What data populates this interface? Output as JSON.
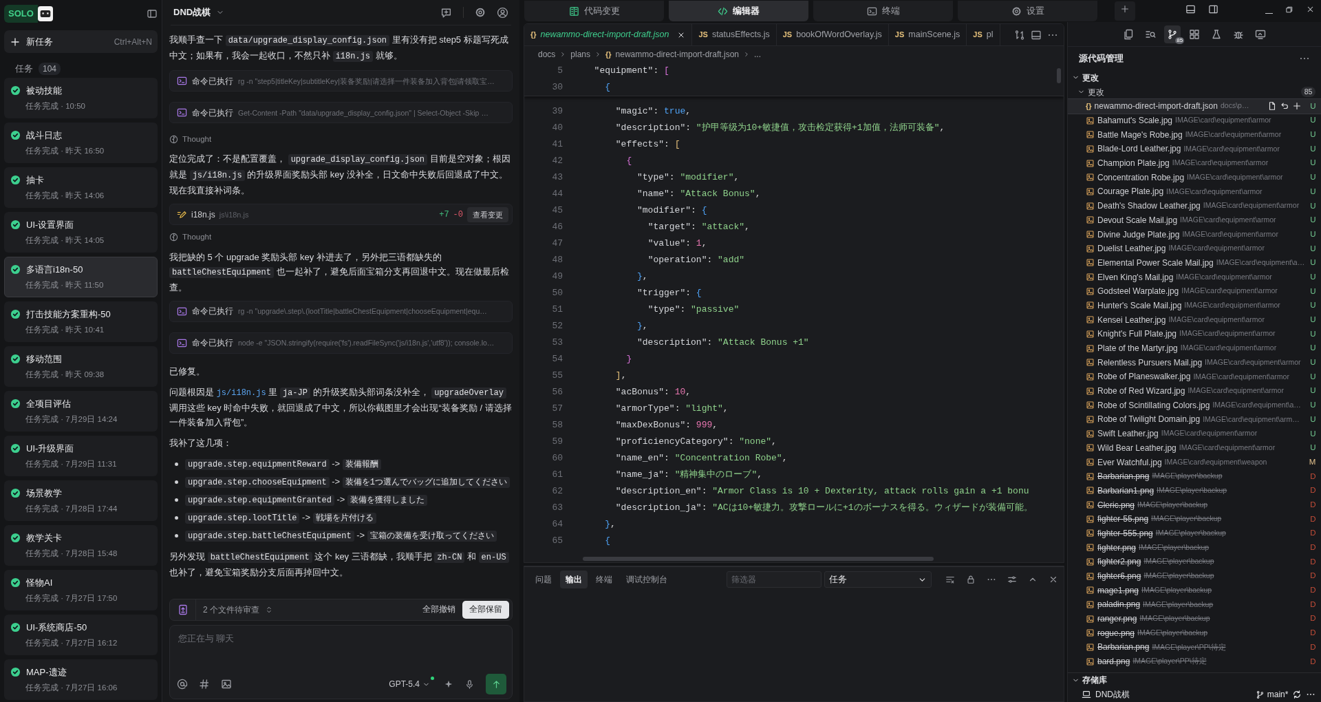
{
  "sidebar": {
    "logo": "SOLO",
    "new_task": {
      "label": "新任务",
      "shortcut": "Ctrl+Alt+N"
    },
    "tasks_label": "任务",
    "tasks_count": "104",
    "items": [
      {
        "title": "被动技能",
        "subtitle": "任务完成 · 10:50",
        "done": true,
        "selected": false
      },
      {
        "title": "战斗日志",
        "subtitle": "任务完成 · 昨天 16:50",
        "done": true,
        "selected": false
      },
      {
        "title": "抽卡",
        "subtitle": "任务完成 · 昨天 14:06",
        "done": true,
        "selected": false
      },
      {
        "title": "UI-设置界面",
        "subtitle": "任务完成 · 昨天 14:05",
        "done": true,
        "selected": false
      },
      {
        "title": "多语言i18n-50",
        "subtitle": "任务完成 · 昨天 11:50",
        "done": true,
        "selected": true
      },
      {
        "title": "打击技能方案重构-50",
        "subtitle": "任务完成 · 昨天 10:41",
        "done": true,
        "selected": false
      },
      {
        "title": "移动范围",
        "subtitle": "任务完成 · 昨天 09:38",
        "done": true,
        "selected": false
      },
      {
        "title": "全项目评估",
        "subtitle": "任务完成 · 7月29日 14:24",
        "done": true,
        "selected": false
      },
      {
        "title": "UI-升级界面",
        "subtitle": "任务完成 · 7月29日 11:31",
        "done": true,
        "selected": false
      },
      {
        "title": "场景教学",
        "subtitle": "任务完成 · 7月28日 17:44",
        "done": true,
        "selected": false
      },
      {
        "title": "教学关卡",
        "subtitle": "任务完成 · 7月28日 15:48",
        "done": true,
        "selected": false
      },
      {
        "title": "怪物AI",
        "subtitle": "任务完成 · 7月27日 17:50",
        "done": true,
        "selected": false
      },
      {
        "title": "UI-系统商店-50",
        "subtitle": "任务完成 · 7月27日 16:12",
        "done": true,
        "selected": false
      },
      {
        "title": "MAP-遗迹",
        "subtitle": "任务完成 · 7月27日 16:06",
        "done": true,
        "selected": false
      }
    ]
  },
  "chat": {
    "title": "DND战棋",
    "messages": [
      {
        "kind": "text",
        "segments": [
          {
            "text": "我顺手查一下 "
          },
          {
            "code": "data/upgrade_display_config.json"
          },
          {
            "text": " 里有没有把 step5 标题写死成中文；如果有，我会一起收口，不然只补 "
          },
          {
            "code": "i18n.js"
          },
          {
            "text": " 就够。"
          }
        ]
      },
      {
        "kind": "command",
        "label": "命令已执行",
        "command": "rg -n \"step5|titleKey|subtitleKey|装备奖励|请选择一件装备加入背包|请领取宝…"
      },
      {
        "kind": "command",
        "label": "命令已执行",
        "command": "Get-Content -Path \"data/upgrade_display_config.json\" | Select-Object -Skip …"
      },
      {
        "kind": "thought",
        "label": "Thought"
      },
      {
        "kind": "text",
        "segments": [
          {
            "text": "定位完成了：不是配置覆盖， "
          },
          {
            "code": "upgrade_display_config.json"
          },
          {
            "text": " 目前是空对象；根因就是 "
          },
          {
            "code": "js/i18n.js"
          },
          {
            "text": " 的升级界面奖励头部 key 没补全，日文命中失败后回退成了中文。现在我直接补词条。"
          }
        ]
      },
      {
        "kind": "file_edit",
        "name": "i18n.js",
        "path": "js\\i18n.js",
        "added": "+7",
        "removed": "-0",
        "button": "查看变更"
      },
      {
        "kind": "thought",
        "label": "Thought"
      },
      {
        "kind": "text",
        "segments": [
          {
            "text": "我把缺的 5 个 upgrade 奖励头部 key 补进去了，另外把三语都缺失的 "
          },
          {
            "code": "battleChestEquipment"
          },
          {
            "text": " 也一起补了，避免后面宝箱分支再回退中文。现在做最后检查。"
          }
        ]
      },
      {
        "kind": "command",
        "label": "命令已执行",
        "command": "rg -n \"upgrade\\.step\\.(lootTitle|battleChestEquipment|chooseEquipment|equ…"
      },
      {
        "kind": "command",
        "label": "命令已执行",
        "command": "node -e \"JSON.stringify(require('fs').readFileSync('js/i18n.js','utf8')); console.lo…"
      },
      {
        "kind": "text",
        "segments": [
          {
            "text": "已修复。"
          }
        ]
      },
      {
        "kind": "text",
        "segments": [
          {
            "text": "问题根因是 "
          },
          {
            "link": "js/i18n.js"
          },
          {
            "text": " 里 "
          },
          {
            "code": "ja-JP"
          },
          {
            "text": " 的升级奖励头部词条没补全， "
          },
          {
            "code": "upgradeOverlay"
          },
          {
            "text": " 调用这些 key 时命中失败，就回退成了中文，所以你截图里才会出现“装备奖励 / 请选择一件装备加入背包”。"
          }
        ]
      },
      {
        "kind": "text",
        "segments": [
          {
            "text": "我补了这几项："
          }
        ]
      },
      {
        "kind": "list",
        "items": [
          [
            {
              "code": "upgrade.step.equipmentReward"
            },
            {
              "text": " -> "
            },
            {
              "code": "装備報酬"
            }
          ],
          [
            {
              "code": "upgrade.step.chooseEquipment"
            },
            {
              "text": " -> "
            },
            {
              "code": "装備を1つ選んでバッグに追加してください"
            }
          ],
          [
            {
              "code": "upgrade.step.equipmentGranted"
            },
            {
              "text": " -> "
            },
            {
              "code": "装備を獲得しました"
            }
          ],
          [
            {
              "code": "upgrade.step.lootTitle"
            },
            {
              "text": " -> "
            },
            {
              "code": "戦場を片付ける"
            }
          ],
          [
            {
              "code": "upgrade.step.battleChestEquipment"
            },
            {
              "text": " -> "
            },
            {
              "code": "宝箱の装備を受け取ってください"
            }
          ]
        ]
      },
      {
        "kind": "text",
        "segments": [
          {
            "text": "另外发现 "
          },
          {
            "code": "battleChestEquipment"
          },
          {
            "text": " 这个 key 三语都缺，我顺手把 "
          },
          {
            "code": "zh-CN"
          },
          {
            "text": " 和 "
          },
          {
            "code": "en-US"
          },
          {
            "text": " 也补了，避免宝箱奖励分支后面再掉回中文。"
          }
        ]
      }
    ],
    "review": {
      "label": "2 个文件待审查",
      "discard": "全部撤销",
      "keep": "全部保留"
    },
    "composer": {
      "placeholder": "您正在与 聊天",
      "model": "GPT-5.4"
    }
  },
  "top_tabs": [
    {
      "label": "代码变更",
      "kind": "diff",
      "selected": false
    },
    {
      "label": "编辑器",
      "kind": "code",
      "selected": true
    },
    {
      "label": "终端",
      "kind": "terminal",
      "selected": false
    },
    {
      "label": "设置",
      "kind": "gear",
      "selected": false
    }
  ],
  "editor": {
    "tabs": [
      {
        "glyph": "{}",
        "label": "newammo-direct-import-draft.json",
        "selected": true
      },
      {
        "glyph": "JS",
        "label": "statusEffects.js",
        "selected": false
      },
      {
        "glyph": "JS",
        "label": "bookOfWordOverlay.js",
        "selected": false
      },
      {
        "glyph": "JS",
        "label": "mainScene.js",
        "selected": false
      },
      {
        "glyph": "JS",
        "label": "pl",
        "selected": false
      }
    ],
    "breadcrumb": [
      {
        "text": "docs"
      },
      {
        "text": "plans"
      },
      {
        "glyph": "{}",
        "text": "newammo-direct-import-draft.json"
      },
      {
        "text": "..."
      }
    ],
    "sticky_lines": [
      {
        "number": "5",
        "code": "  \"equipment\": ["
      },
      {
        "number": "30",
        "code": "    {"
      }
    ],
    "lines": [
      {
        "number": "39",
        "code": "      \"magic\": true,"
      },
      {
        "number": "40",
        "code": "      \"description\": \"护甲等级为10+敏捷值，攻击检定获得+1加值，法师可装备\","
      },
      {
        "number": "41",
        "code": "      \"effects\": ["
      },
      {
        "number": "42",
        "code": "        {"
      },
      {
        "number": "43",
        "code": "          \"type\": \"modifier\","
      },
      {
        "number": "44",
        "code": "          \"name\": \"Attack Bonus\","
      },
      {
        "number": "45",
        "code": "          \"modifier\": {"
      },
      {
        "number": "46",
        "code": "            \"target\": \"attack\","
      },
      {
        "number": "47",
        "code": "            \"value\": 1,"
      },
      {
        "number": "48",
        "code": "            \"operation\": \"add\""
      },
      {
        "number": "49",
        "code": "          },"
      },
      {
        "number": "50",
        "code": "          \"trigger\": {"
      },
      {
        "number": "51",
        "code": "            \"type\": \"passive\""
      },
      {
        "number": "52",
        "code": "          },"
      },
      {
        "number": "53",
        "code": "          \"description\": \"Attack Bonus +1\""
      },
      {
        "number": "54",
        "code": "        }"
      },
      {
        "number": "55",
        "code": "      ],"
      },
      {
        "number": "56",
        "code": "      \"acBonus\": 10,"
      },
      {
        "number": "57",
        "code": "      \"armorType\": \"light\","
      },
      {
        "number": "58",
        "code": "      \"maxDexBonus\": 999,"
      },
      {
        "number": "59",
        "code": "      \"proficiencyCategory\": \"none\","
      },
      {
        "number": "60",
        "code": "      \"name_en\": \"Concentration Robe\","
      },
      {
        "number": "61",
        "code": "      \"name_ja\": \"精神集中のローブ\","
      },
      {
        "number": "62",
        "code": "      \"description_en\": \"Armor Class is 10 + Dexterity, attack rolls gain a +1 bonu"
      },
      {
        "number": "63",
        "code": "      \"description_ja\": \"ACは10+敏捷力。攻撃ロールに+1のボーナスを得る。ウィザードが装備可能。"
      },
      {
        "number": "64",
        "code": "    },"
      },
      {
        "number": "65",
        "code": "    {"
      }
    ]
  },
  "panel": {
    "tabs": [
      {
        "label": "问题",
        "selected": false
      },
      {
        "label": "输出",
        "selected": true
      },
      {
        "label": "终端",
        "selected": false
      },
      {
        "label": "调试控制台",
        "selected": false
      }
    ],
    "filter_placeholder": "筛选器",
    "channel": "任务"
  },
  "scm": {
    "activity": [
      {
        "kind": "files",
        "selected": false
      },
      {
        "kind": "search",
        "selected": false
      },
      {
        "kind": "branch",
        "selected": true,
        "badge": "85"
      },
      {
        "kind": "grid",
        "selected": false
      },
      {
        "kind": "flask",
        "selected": false
      },
      {
        "kind": "bug",
        "selected": false
      },
      {
        "kind": "remote",
        "selected": false
      }
    ],
    "title": "源代码管理",
    "section": {
      "label": "更改",
      "expanded": true
    },
    "group": {
      "label": "更改",
      "count": "85",
      "expanded": true
    },
    "files": [
      {
        "glyph": "{}",
        "name": "newammo-direct-import-draft.json",
        "path": "docs\\p…",
        "status": "U",
        "kind": "untracked",
        "selected": true
      },
      {
        "name": "Bahamut's Scale.jpg",
        "path": "IMAGE\\card\\equipment\\armor",
        "status": "U",
        "kind": "untracked",
        "selected": false
      },
      {
        "name": "Battle Mage's Robe.jpg",
        "path": "IMAGE\\card\\equipment\\armor",
        "status": "U",
        "kind": "untracked",
        "selected": false
      },
      {
        "name": "Blade-Lord Leather.jpg",
        "path": "IMAGE\\card\\equipment\\armor",
        "status": "U",
        "kind": "untracked",
        "selected": false
      },
      {
        "name": "Champion Plate.jpg",
        "path": "IMAGE\\card\\equipment\\armor",
        "status": "U",
        "kind": "untracked",
        "selected": false
      },
      {
        "name": "Concentration Robe.jpg",
        "path": "IMAGE\\card\\equipment\\armor",
        "status": "U",
        "kind": "untracked",
        "selected": false
      },
      {
        "name": "Courage Plate.jpg",
        "path": "IMAGE\\card\\equipment\\armor",
        "status": "U",
        "kind": "untracked",
        "selected": false
      },
      {
        "name": "Death's Shadow Leather.jpg",
        "path": "IMAGE\\card\\equipment\\armor",
        "status": "U",
        "kind": "untracked",
        "selected": false
      },
      {
        "name": "Devout Scale Mail.jpg",
        "path": "IMAGE\\card\\equipment\\armor",
        "status": "U",
        "kind": "untracked",
        "selected": false
      },
      {
        "name": "Divine Judge Plate.jpg",
        "path": "IMAGE\\card\\equipment\\armor",
        "status": "U",
        "kind": "untracked",
        "selected": false
      },
      {
        "name": "Duelist Leather.jpg",
        "path": "IMAGE\\card\\equipment\\armor",
        "status": "U",
        "kind": "untracked",
        "selected": false
      },
      {
        "name": "Elemental Power Scale Mail.jpg",
        "path": "IMAGE\\card\\equipment\\a…",
        "status": "U",
        "kind": "untracked",
        "selected": false
      },
      {
        "name": "Elven King's Mail.jpg",
        "path": "IMAGE\\card\\equipment\\armor",
        "status": "U",
        "kind": "untracked",
        "selected": false
      },
      {
        "name": "Godsteel Warplate.jpg",
        "path": "IMAGE\\card\\equipment\\armor",
        "status": "U",
        "kind": "untracked",
        "selected": false
      },
      {
        "name": "Hunter's Scale Mail.jpg",
        "path": "IMAGE\\card\\equipment\\armor",
        "status": "U",
        "kind": "untracked",
        "selected": false
      },
      {
        "name": "Kensei Leather.jpg",
        "path": "IMAGE\\card\\equipment\\armor",
        "status": "U",
        "kind": "untracked",
        "selected": false
      },
      {
        "name": "Knight's Full Plate.jpg",
        "path": "IMAGE\\card\\equipment\\armor",
        "status": "U",
        "kind": "untracked",
        "selected": false
      },
      {
        "name": "Plate of the Martyr.jpg",
        "path": "IMAGE\\card\\equipment\\armor",
        "status": "U",
        "kind": "untracked",
        "selected": false
      },
      {
        "name": "Relentless Pursuers Mail.jpg",
        "path": "IMAGE\\card\\equipment\\armor",
        "status": "U",
        "kind": "untracked",
        "selected": false
      },
      {
        "name": "Robe of Planeswalker.jpg",
        "path": "IMAGE\\card\\equipment\\armor",
        "status": "U",
        "kind": "untracked",
        "selected": false
      },
      {
        "name": "Robe of Red Wizard.jpg",
        "path": "IMAGE\\card\\equipment\\armor",
        "status": "U",
        "kind": "untracked",
        "selected": false
      },
      {
        "name": "Robe of Scintillating Colors.jpg",
        "path": "IMAGE\\card\\equipment\\a…",
        "status": "U",
        "kind": "untracked",
        "selected": false
      },
      {
        "name": "Robe of Twilight Domain.jpg",
        "path": "IMAGE\\card\\equipment\\arm…",
        "status": "U",
        "kind": "untracked",
        "selected": false
      },
      {
        "name": "Swift Leather.jpg",
        "path": "IMAGE\\card\\equipment\\armor",
        "status": "U",
        "kind": "untracked",
        "selected": false
      },
      {
        "name": "Wild Bear Leather.jpg",
        "path": "IMAGE\\card\\equipment\\armor",
        "status": "U",
        "kind": "untracked",
        "selected": false
      },
      {
        "name": "Ever Watchful.jpg",
        "path": "IMAGE\\card\\equipment\\weapon",
        "status": "M",
        "kind": "modified",
        "selected": false
      },
      {
        "name": "Barbarian.png",
        "path": "IMAGE\\player\\backup",
        "status": "D",
        "kind": "deleted",
        "selected": false
      },
      {
        "name": "Barbarian1.png",
        "path": "IMAGE\\player\\backup",
        "status": "D",
        "kind": "deleted",
        "selected": false
      },
      {
        "name": "Cleric.png",
        "path": "IMAGE\\player\\backup",
        "status": "D",
        "kind": "deleted",
        "selected": false
      },
      {
        "name": "fighter-55.png",
        "path": "IMAGE\\player\\backup",
        "status": "D",
        "kind": "deleted",
        "selected": false
      },
      {
        "name": "fighter-555.png",
        "path": "IMAGE\\player\\backup",
        "status": "D",
        "kind": "deleted",
        "selected": false
      },
      {
        "name": "fighter.png",
        "path": "IMAGE\\player\\backup",
        "status": "D",
        "kind": "deleted",
        "selected": false
      },
      {
        "name": "fighter2.png",
        "path": "IMAGE\\player\\backup",
        "status": "D",
        "kind": "deleted",
        "selected": false
      },
      {
        "name": "fighter6.png",
        "path": "IMAGE\\player\\backup",
        "status": "D",
        "kind": "deleted",
        "selected": false
      },
      {
        "name": "mage1.png",
        "path": "IMAGE\\player\\backup",
        "status": "D",
        "kind": "deleted",
        "selected": false
      },
      {
        "name": "paladin.png",
        "path": "IMAGE\\player\\backup",
        "status": "D",
        "kind": "deleted",
        "selected": false
      },
      {
        "name": "ranger.png",
        "path": "IMAGE\\player\\backup",
        "status": "D",
        "kind": "deleted",
        "selected": false
      },
      {
        "name": "rogue.png",
        "path": "IMAGE\\player\\backup",
        "status": "D",
        "kind": "deleted",
        "selected": false
      },
      {
        "name": "Barbarian.png",
        "path": "IMAGE\\player\\PP\\待定",
        "status": "D",
        "kind": "deleted",
        "selected": false
      },
      {
        "name": "bard.png",
        "path": "IMAGE\\player\\PP\\待定",
        "status": "D",
        "kind": "deleted",
        "selected": false
      }
    ],
    "repositories": {
      "label": "存储库",
      "expanded": true,
      "name": "DND战棋",
      "branch": "main*"
    }
  }
}
